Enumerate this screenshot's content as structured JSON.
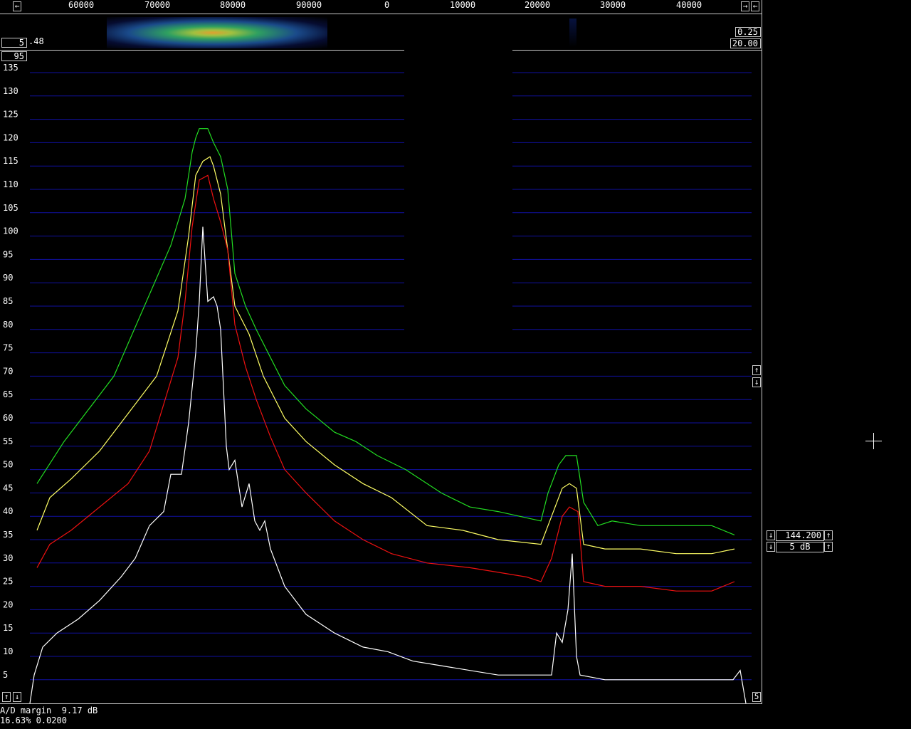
{
  "scale": {
    "freq_labels": [
      "60000",
      "70000",
      "80000",
      "90000",
      "0",
      "10000",
      "20000",
      "30000",
      "40000"
    ]
  },
  "controls": {
    "top_left_arrow": "←",
    "top_right_arrow_right": "→",
    "top_right_arrow_left": "←",
    "wf_left_value": "5",
    "wf_left_suffix": ".48",
    "wf_right_top": "0.25",
    "wf_right_bottom": "20.00",
    "spectrum_top_value": "95",
    "bottom_left_up": "↑",
    "bottom_left_down": "↓",
    "bottom_right_value": "5",
    "right_up": "↑",
    "right_down": "↓",
    "freq_box_value": "144.200",
    "db_box_value": "5 dB"
  },
  "status": {
    "line1": "A/D margin  9.17 dB",
    "line2": "16.63% 0.0200"
  },
  "chart_data": {
    "type": "line",
    "y_tick_labels": [
      "135",
      "130",
      "125",
      "120",
      "115",
      "110",
      "105",
      "100",
      "95",
      "90",
      "85",
      "80",
      "75",
      "70",
      "65",
      "60",
      "55",
      "50",
      "45",
      "40",
      "35",
      "30",
      "25",
      "20",
      "15",
      "10",
      "5"
    ],
    "x_tick_labels": [
      "60000",
      "70000",
      "80000",
      "90000",
      "0",
      "10000",
      "20000",
      "30000",
      "40000"
    ],
    "ylim": [
      0,
      140
    ],
    "grid": true,
    "colors": {
      "green": "#22dd22",
      "yellow": "#ffff66",
      "red": "#ee1111",
      "white": "#ffffff",
      "grid": "#1010a0"
    },
    "series": [
      {
        "color": "green",
        "values": [
          [
            52,
            47
          ],
          [
            90,
            56
          ],
          [
            120,
            62
          ],
          [
            160,
            70
          ],
          [
            200,
            84
          ],
          [
            240,
            98
          ],
          [
            260,
            108
          ],
          [
            270,
            118
          ],
          [
            275,
            121
          ],
          [
            280,
            123
          ],
          [
            292,
            123
          ],
          [
            300,
            120
          ],
          [
            310,
            117
          ],
          [
            320,
            110
          ],
          [
            330,
            92
          ],
          [
            345,
            85
          ],
          [
            360,
            80
          ],
          [
            380,
            74
          ],
          [
            400,
            68
          ],
          [
            430,
            63
          ],
          [
            470,
            58
          ],
          [
            500,
            56
          ],
          [
            530,
            53
          ],
          [
            570,
            50
          ],
          [
            600,
            47
          ],
          [
            620,
            45
          ],
          [
            660,
            42
          ],
          [
            700,
            41
          ],
          [
            730,
            40
          ],
          [
            760,
            39
          ],
          [
            770,
            45
          ],
          [
            785,
            51
          ],
          [
            795,
            53
          ],
          [
            810,
            53
          ],
          [
            820,
            43
          ],
          [
            840,
            38
          ],
          [
            860,
            39
          ],
          [
            900,
            38
          ],
          [
            950,
            38
          ],
          [
            1000,
            38
          ],
          [
            1032,
            36
          ]
        ]
      },
      {
        "color": "yellow",
        "values": [
          [
            52,
            37
          ],
          [
            70,
            44
          ],
          [
            100,
            48
          ],
          [
            140,
            54
          ],
          [
            180,
            62
          ],
          [
            220,
            70
          ],
          [
            250,
            84
          ],
          [
            265,
            100
          ],
          [
            275,
            113
          ],
          [
            285,
            116
          ],
          [
            295,
            117
          ],
          [
            300,
            115
          ],
          [
            310,
            109
          ],
          [
            320,
            97
          ],
          [
            330,
            85
          ],
          [
            350,
            79
          ],
          [
            370,
            70
          ],
          [
            400,
            61
          ],
          [
            430,
            56
          ],
          [
            470,
            51
          ],
          [
            510,
            47
          ],
          [
            550,
            44
          ],
          [
            600,
            38
          ],
          [
            650,
            37
          ],
          [
            700,
            35
          ],
          [
            760,
            34
          ],
          [
            775,
            40
          ],
          [
            790,
            46
          ],
          [
            800,
            47
          ],
          [
            810,
            46
          ],
          [
            820,
            34
          ],
          [
            850,
            33
          ],
          [
            900,
            33
          ],
          [
            950,
            32
          ],
          [
            1000,
            32
          ],
          [
            1032,
            33
          ]
        ]
      },
      {
        "color": "red",
        "values": [
          [
            52,
            29
          ],
          [
            70,
            34
          ],
          [
            100,
            37
          ],
          [
            140,
            42
          ],
          [
            180,
            47
          ],
          [
            210,
            54
          ],
          [
            230,
            64
          ],
          [
            250,
            74
          ],
          [
            260,
            86
          ],
          [
            270,
            102
          ],
          [
            280,
            112
          ],
          [
            292,
            113
          ],
          [
            300,
            108
          ],
          [
            310,
            103
          ],
          [
            320,
            97
          ],
          [
            330,
            81
          ],
          [
            345,
            72
          ],
          [
            360,
            65
          ],
          [
            380,
            57
          ],
          [
            400,
            50
          ],
          [
            430,
            45
          ],
          [
            470,
            39
          ],
          [
            510,
            35
          ],
          [
            550,
            32
          ],
          [
            600,
            30
          ],
          [
            660,
            29
          ],
          [
            700,
            28
          ],
          [
            740,
            27
          ],
          [
            760,
            26
          ],
          [
            775,
            31
          ],
          [
            790,
            40
          ],
          [
            800,
            42
          ],
          [
            812,
            41
          ],
          [
            820,
            26
          ],
          [
            850,
            25
          ],
          [
            900,
            25
          ],
          [
            950,
            24
          ],
          [
            1000,
            24
          ],
          [
            1032,
            26
          ]
        ]
      },
      {
        "color": "white",
        "values": [
          [
            42,
            0
          ],
          [
            48,
            6
          ],
          [
            60,
            12
          ],
          [
            80,
            15
          ],
          [
            110,
            18
          ],
          [
            140,
            22
          ],
          [
            170,
            27
          ],
          [
            190,
            31
          ],
          [
            210,
            38
          ],
          [
            230,
            41
          ],
          [
            240,
            49
          ],
          [
            255,
            49
          ],
          [
            265,
            60
          ],
          [
            275,
            75
          ],
          [
            280,
            86
          ],
          [
            285,
            102
          ],
          [
            288,
            95
          ],
          [
            292,
            86
          ],
          [
            300,
            87
          ],
          [
            305,
            85
          ],
          [
            310,
            80
          ],
          [
            318,
            55
          ],
          [
            322,
            50
          ],
          [
            330,
            52
          ],
          [
            340,
            42
          ],
          [
            350,
            47
          ],
          [
            358,
            39
          ],
          [
            365,
            37
          ],
          [
            372,
            39
          ],
          [
            380,
            33
          ],
          [
            400,
            25
          ],
          [
            430,
            19
          ],
          [
            470,
            15
          ],
          [
            510,
            12
          ],
          [
            545,
            11
          ],
          [
            580,
            9
          ],
          [
            620,
            8
          ],
          [
            660,
            7
          ],
          [
            700,
            6
          ],
          [
            740,
            6
          ],
          [
            775,
            6
          ],
          [
            782,
            15
          ],
          [
            790,
            13
          ],
          [
            798,
            20
          ],
          [
            804,
            32
          ],
          [
            810,
            10
          ],
          [
            815,
            6
          ],
          [
            850,
            5
          ],
          [
            900,
            5
          ],
          [
            950,
            5
          ],
          [
            1000,
            5
          ],
          [
            1030,
            5
          ],
          [
            1040,
            7
          ],
          [
            1048,
            0
          ]
        ]
      }
    ]
  }
}
